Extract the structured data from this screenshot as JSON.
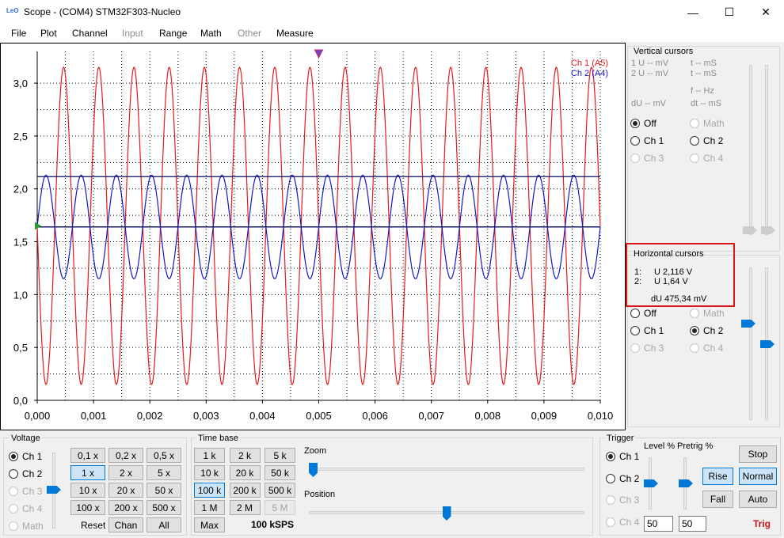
{
  "window": {
    "title": "Scope - (COM4) STM32F303-Nucleo",
    "icon": "scope-app-icon",
    "minimize": "—",
    "maximize": "☐",
    "close": "✕"
  },
  "menu": [
    "File",
    "Plot",
    "Channel",
    "Input",
    "Range",
    "Math",
    "Other",
    "Measure"
  ],
  "menu_disabled": [
    false,
    false,
    false,
    true,
    false,
    false,
    true,
    false
  ],
  "plot": {
    "y_ticks": [
      "3,0",
      "2,5",
      "2,0",
      "1,5",
      "1,0",
      "0,5",
      "0,0"
    ],
    "x_ticks": [
      "0,000",
      "0,001",
      "0,002",
      "0,003",
      "0,004",
      "0,005",
      "0,006",
      "0,007",
      "0,008",
      "0,009",
      "0,010"
    ],
    "legend": [
      {
        "name": "Ch 1 (A5)",
        "color": "#e8191e"
      },
      {
        "name": "Ch 2 (A4)",
        "color": "#1416c8"
      }
    ],
    "cursor_color": "#0b0b5c"
  },
  "chart_data": {
    "type": "line",
    "xlim": [
      0,
      0.01
    ],
    "ylim": [
      0,
      3.3
    ],
    "grid": true,
    "legend_position": "top-right",
    "series": [
      {
        "name": "Ch 1 (A5)",
        "color": "#e8191e",
        "kind": "sine",
        "offset": 1.65,
        "amplitude": 1.5,
        "frequency_hz": 1600,
        "phase_deg": 180
      },
      {
        "name": "Ch 2 (A4)",
        "color": "#1416c8",
        "kind": "sine",
        "offset": 1.64,
        "amplitude": 0.49,
        "frequency_hz": 1600,
        "phase_deg": 0
      }
    ],
    "horizontal_cursors": [
      2.116,
      1.64
    ],
    "trigger_time": 0.005,
    "trigger_level": 1.65
  },
  "vertical_cursors": {
    "title": "Vertical cursors",
    "row1": "1  U -- mV",
    "row1b": "t -- mS",
    "row2": "2  U -- mV",
    "row2b": "t -- mS",
    "freq": "f -- Hz",
    "du": "dU -- mV",
    "dt": "dt -- mS",
    "options": [
      {
        "label": "Off",
        "checked": true,
        "disabled": false
      },
      {
        "label": "Math",
        "checked": false,
        "disabled": true
      },
      {
        "label": "Ch 1",
        "checked": false,
        "disabled": false
      },
      {
        "label": "Ch 2",
        "checked": false,
        "disabled": false
      },
      {
        "label": "Ch 3",
        "checked": false,
        "disabled": true
      },
      {
        "label": "Ch 4",
        "checked": false,
        "disabled": true
      }
    ]
  },
  "horizontal_cursors": {
    "title": "Horizontal cursors",
    "c1_label": "1:",
    "c1_value": "U 2,116 V",
    "c2_label": "2:",
    "c2_value": "U 1,64 V",
    "du": "dU 475,34 mV",
    "options": [
      {
        "label": "Off",
        "checked": false,
        "disabled": false
      },
      {
        "label": "Math",
        "checked": false,
        "disabled": true
      },
      {
        "label": "Ch 1",
        "checked": false,
        "disabled": false
      },
      {
        "label": "Ch 2",
        "checked": true,
        "disabled": false
      },
      {
        "label": "Ch 3",
        "checked": false,
        "disabled": true
      },
      {
        "label": "Ch 4",
        "checked": false,
        "disabled": true
      }
    ],
    "highlight_color": "#d9141b"
  },
  "voltage": {
    "title": "Voltage",
    "channels": [
      {
        "label": "Ch 1",
        "checked": true,
        "disabled": false
      },
      {
        "label": "Ch 2",
        "checked": false,
        "disabled": false
      },
      {
        "label": "Ch 3",
        "checked": false,
        "disabled": true
      },
      {
        "label": "Ch 4",
        "checked": false,
        "disabled": true
      },
      {
        "label": "Math",
        "checked": false,
        "disabled": true
      }
    ],
    "buttons": [
      "0,1 x",
      "0,2 x",
      "0,5 x",
      "1 x",
      "2 x",
      "5 x",
      "10 x",
      "20 x",
      "50 x",
      "100 x",
      "200 x",
      "500 x"
    ],
    "selected": "1 x",
    "reset": "Reset",
    "chan": "Chan",
    "all": "All"
  },
  "timebase": {
    "title": "Time base",
    "buttons": [
      "1 k",
      "2 k",
      "5 k",
      "10 k",
      "20 k",
      "50 k",
      "100 k",
      "200 k",
      "500 k",
      "1 M",
      "2 M",
      "5 M"
    ],
    "selected": "100 k",
    "disabled": [
      "5 M"
    ],
    "max": "Max",
    "rate": "100 kSPS",
    "zoom": "Zoom",
    "position": "Position",
    "zoom_level": 0.0,
    "position_level": 0.5
  },
  "trigger": {
    "title": "Trigger",
    "level_label": "Level %",
    "pretrig_label": "Pretrig %",
    "channels": [
      {
        "label": "Ch 1",
        "checked": true,
        "disabled": false
      },
      {
        "label": "Ch 2",
        "checked": false,
        "disabled": false
      },
      {
        "label": "Ch 3",
        "checked": false,
        "disabled": true
      },
      {
        "label": "Ch 4",
        "checked": false,
        "disabled": true
      }
    ],
    "level_value": "50",
    "pretrig_value": "50",
    "stop": "Stop",
    "rise": "Rise",
    "normal": "Normal",
    "fall": "Fall",
    "auto": "Auto",
    "status": "Trig",
    "status_color": "#c4161c"
  }
}
